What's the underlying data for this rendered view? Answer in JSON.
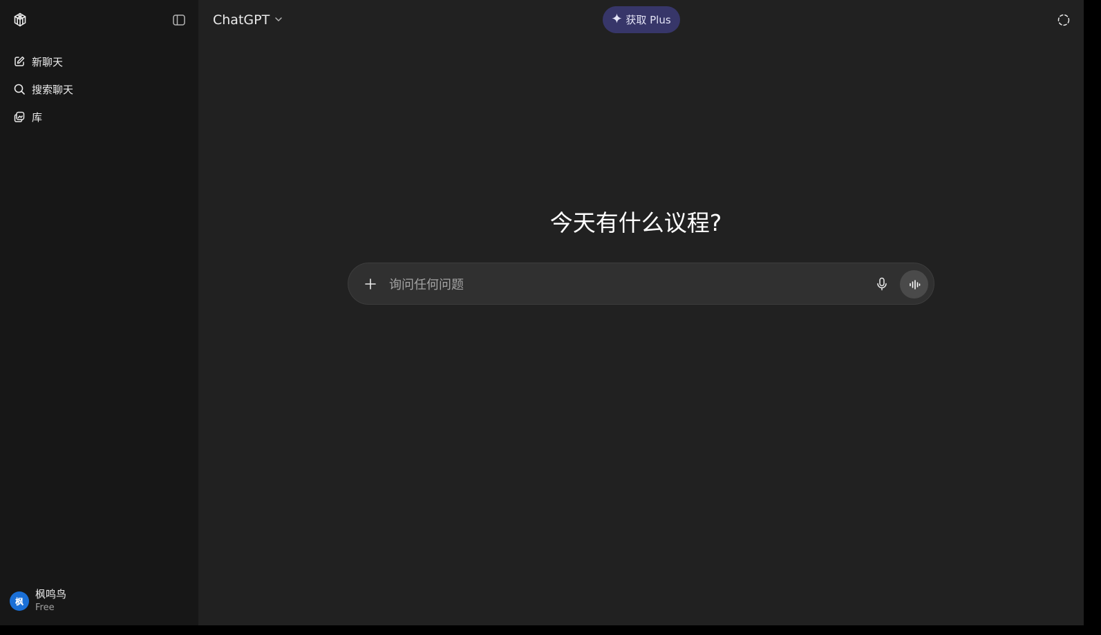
{
  "header": {
    "model_name": "ChatGPT",
    "upgrade_label": "获取 Plus"
  },
  "sidebar": {
    "items": [
      {
        "label": "新聊天",
        "icon": "new-chat-icon"
      },
      {
        "label": "搜索聊天",
        "icon": "search-icon"
      },
      {
        "label": "库",
        "icon": "library-icon"
      }
    ],
    "user": {
      "avatar_text": "枫",
      "name": "枫鸣鸟",
      "plan": "Free"
    }
  },
  "main": {
    "greeting": "今天有什么议程?",
    "composer": {
      "placeholder": "询问任何问题"
    }
  },
  "colors": {
    "app_bg": "#212121",
    "sidebar_bg": "#171717",
    "upgrade_bg": "#373669",
    "composer_bg": "#303030",
    "avatar_bg": "#1a6fd6"
  }
}
